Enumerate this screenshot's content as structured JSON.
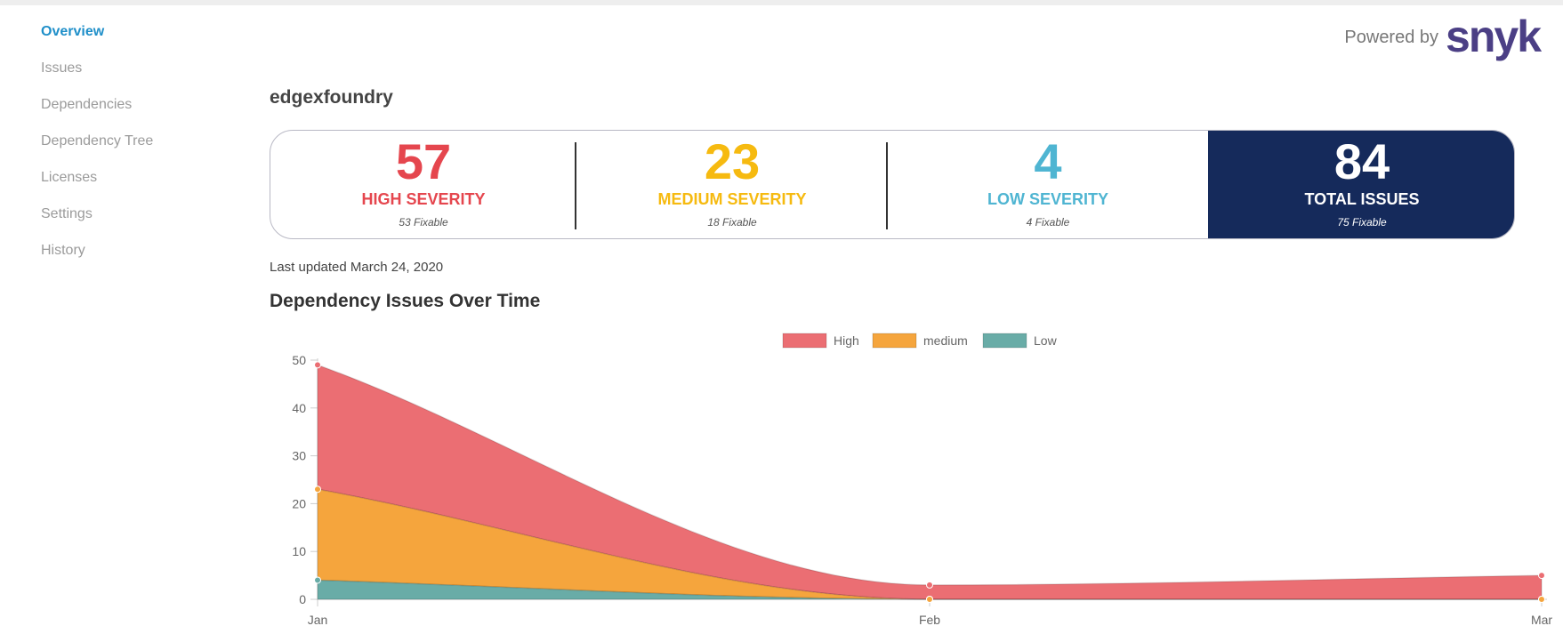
{
  "sidebar": {
    "items": [
      {
        "label": "Overview",
        "active": true
      },
      {
        "label": "Issues"
      },
      {
        "label": "Dependencies"
      },
      {
        "label": "Dependency Tree"
      },
      {
        "label": "Licenses"
      },
      {
        "label": "Settings"
      },
      {
        "label": "History"
      }
    ]
  },
  "header": {
    "powered_by": "Powered by",
    "logo": "snyk"
  },
  "project": {
    "title": "edgexfoundry"
  },
  "summary": {
    "high": {
      "count": "57",
      "label": "HIGH SEVERITY",
      "fixable": "53 Fixable",
      "color": "#e5464e"
    },
    "medium": {
      "count": "23",
      "label": "MEDIUM SEVERITY",
      "fixable": "18 Fixable",
      "color": "#f6ba10"
    },
    "low": {
      "count": "4",
      "label": "LOW SEVERITY",
      "fixable": "4 Fixable",
      "color": "#4fb5d2"
    },
    "total": {
      "count": "84",
      "label": "TOTAL ISSUES",
      "fixable": "75 Fixable",
      "color": "#152a5b"
    }
  },
  "last_updated": "Last updated March 24, 2020",
  "chart_title": "Dependency Issues Over Time",
  "chart_data": {
    "type": "area",
    "stacked": true,
    "x": [
      "Jan",
      "Feb",
      "Mar"
    ],
    "ylim": [
      0,
      50
    ],
    "yticks": [
      0,
      10,
      20,
      30,
      40,
      50
    ],
    "legend_position": "top-center",
    "series": [
      {
        "name": "High",
        "values": [
          26,
          3,
          5
        ],
        "color": "#eb6e73"
      },
      {
        "name": "medium",
        "values": [
          19,
          0,
          0
        ],
        "color": "#f5a53d"
      },
      {
        "name": "Low",
        "values": [
          4,
          0,
          0
        ],
        "color": "#69aca7"
      }
    ]
  }
}
